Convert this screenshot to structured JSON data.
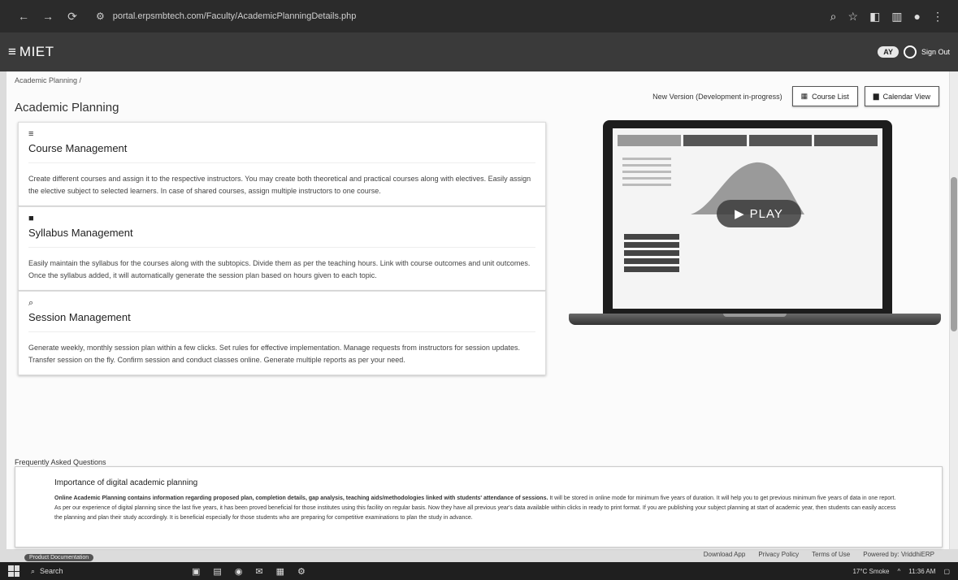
{
  "browser": {
    "url": "portal.erpsmbtech.com/Faculty/AcademicPlanningDetails.php",
    "nav_back": "←",
    "nav_forward": "→",
    "reload": "⟳",
    "icons": [
      "search-icon",
      "star-icon",
      "extension-icon",
      "sidepanel-icon",
      "profile-icon",
      "menu-icon"
    ]
  },
  "header": {
    "menu_icon": "≡",
    "brand": "MIET",
    "ay_badge": "AY",
    "signout": "Sign Out"
  },
  "breadcrumb": "Academic Planning /",
  "page_title": "Academic Planning",
  "top_actions": {
    "dev_note": "New Version (Development in-progress)",
    "course_list": "Course List",
    "calendar_view": "Calendar View"
  },
  "cards": [
    {
      "icon": "≡",
      "title": "Course Management",
      "desc": "Create different courses and assign it to the respective instructors. You may create both theoretical and practical courses along with electives. Easily assign the elective subject to selected learners. In case of shared courses, assign multiple instructors to one course."
    },
    {
      "icon": "■",
      "title": "Syllabus Management",
      "desc": "Easily maintain the syllabus for the courses along with the subtopics. Divide them as per the teaching hours. Link with course outcomes and unit outcomes. Once the syllabus added, it will automatically generate the session plan based on hours given to each topic."
    },
    {
      "icon": "⌕",
      "title": "Session Management",
      "desc": "Generate weekly, monthly session plan within a few clicks. Set rules for effective implementation. Manage requests from instructors for session updates. Transfer session on the fly. Confirm session and conduct classes online. Generate multiple reports as per your need."
    }
  ],
  "video": {
    "play_label": "PLAY"
  },
  "faq": {
    "label": "Frequently Asked Questions",
    "question": "Importance of digital academic planning",
    "answer_bold": "Online Academic Planning contains information regarding proposed plan, completion details, gap analysis, teaching aids/methodologies linked with students' attendance of sessions.",
    "answer_rest": " It will be stored in online mode for minimum five years of duration. It will help you to get previous minimum five years of data in one report. As per our experience of digital planning since the last five years, it has been proved beneficial for those institutes using this facility on regular basis. Now they have all previous year's data available within clicks in ready to print format. If you are publishing your subject planning at start of academic year, then students can easily access the planning and plan their study accordingly. It is beneficial especially for those students who are preparing for competitive examinations to plan the study in advance."
  },
  "footer": {
    "download_app": "Download App",
    "privacy": "Privacy Policy",
    "terms": "Terms of Use",
    "powered": "Powered by: VriddhiERP",
    "product_pill": "Product Documentation"
  },
  "taskbar": {
    "search": "Search",
    "weather": "17°C Smoke",
    "time": "11:36 AM"
  }
}
